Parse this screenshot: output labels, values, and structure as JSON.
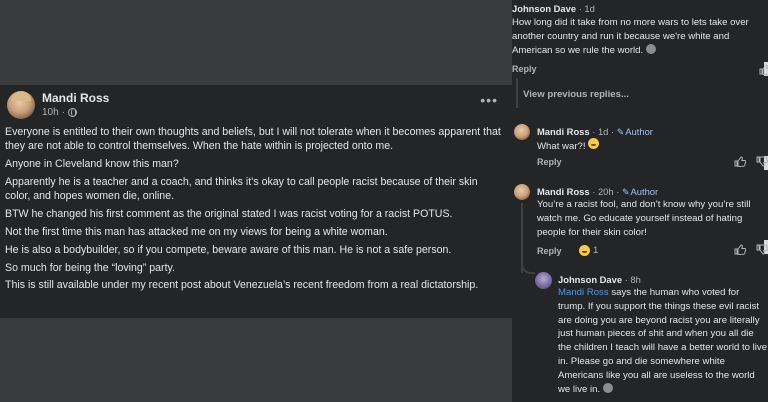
{
  "post": {
    "author": "Mandi Ross",
    "time": "10h",
    "more_label": "•••",
    "paragraphs": [
      "Everyone is entitled to their own thoughts and beliefs, but I will not tolerate when it becomes apparent that they are not able to control themselves. When the hate within is projected onto me.",
      "Anyone in Cleveland know this man?",
      "Apparently he is a teacher and a coach, and thinks it’s okay to call people racist because of their skin color, and hopes women die, online.",
      "BTW he changed his first comment as the original stated I was racist voting for a racist POTUS.",
      "Not the first time this man has attacked me on my views for being a white woman.",
      "He is also a bodybuilder, so if you compete, beware aware of this man. He is not a safe person.",
      "So much for being the “loving” party.",
      "This is still available under my recent post about Venezuela’s recent freedom from a real dictatorship."
    ]
  },
  "comments": {
    "top": {
      "author": "Johnson Dave",
      "meta": "· 1d",
      "text": "How long did it take from no more wars to lets take over another country and run it because we're white and American so we rule the world.",
      "reply": "Reply"
    },
    "view_previous": "View previous replies...",
    "c1": {
      "author": "Mandi Ross",
      "meta": "· 1d ·",
      "badge": "Author",
      "text": "What war?!",
      "reply": "Reply"
    },
    "c2": {
      "author": "Mandi Ross",
      "meta": "· 20h ·",
      "badge": "Author",
      "text": "You’re a racist fool, and don’t know why you’re still watch me. Go educate yourself instead of hating people for their skin color!",
      "reply": "Reply",
      "reaction_count": "1"
    },
    "c3": {
      "author": "Johnson Dave",
      "meta": "· 8h",
      "mention": "Mandi Ross",
      "text": " says the human who voted for trump. If you support the things these evil racist are doing you are beyond racist you are literally  just human pieces of shit and when you all die the children I teach will have a better world to live in. Please go and die somewhere white Americans like you all are useless to the world we live in."
    }
  },
  "colors": {
    "background": "#3a3b3c",
    "card": "#242526",
    "text": "#e4e6eb",
    "muted": "#b0b3b8",
    "link": "#4599ff",
    "author_badge": "#9fc1ff"
  }
}
